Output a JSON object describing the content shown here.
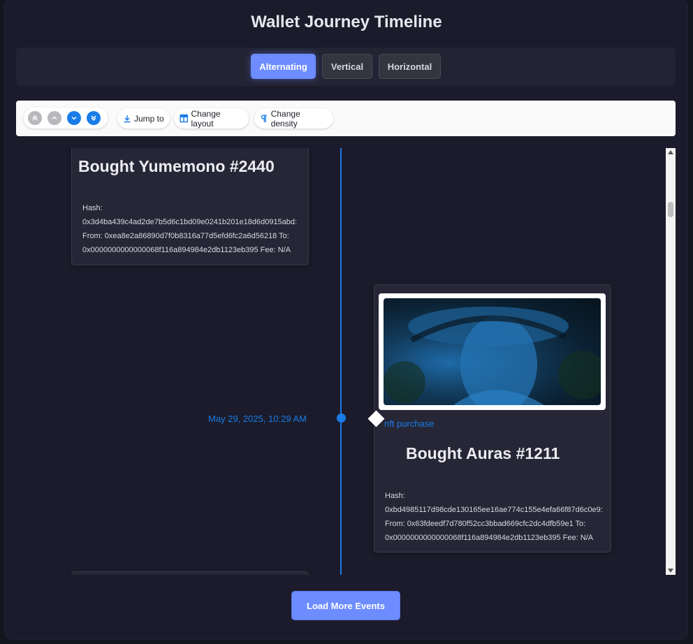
{
  "page": {
    "title": "Wallet Journey Timeline"
  },
  "layout_modes": {
    "buttons": [
      "Alternating",
      "Vertical",
      "Horizontal"
    ],
    "active": "Alternating"
  },
  "toolbar": {
    "nav_icons": [
      "first-event-icon",
      "previous-event-icon",
      "next-event-icon",
      "last-event-icon"
    ],
    "jump_to": "Jump to",
    "change_layout": "Change layout",
    "change_density": "Change density"
  },
  "events": [
    {
      "title": "Bought Yumemono #2440",
      "hash_label": "Hash:",
      "hash": "0x3d4ba439c4ad2de7b5d6c1bd09e0241b201e18d6d0915abd:",
      "from_to": "From: 0xea8e2a86890d7f0b8316a77d5efd6fc2a6d56218 To:",
      "to_fee": "0x0000000000000068f116a894984e2db1123eb395 Fee: N/A"
    },
    {
      "date": "May 29, 2025, 10:29 AM",
      "type": "nft purchase",
      "title": "Bought Auras #1211",
      "hash_label": "Hash:",
      "hash": "0xbd4985117d98cde130165ee16ae774c155e4efa66f87d6c0e9:",
      "from_to": "From: 0x63fdeedf7d780f52cc3bbad669cfc2dc4dfb59e1 To:",
      "to_fee": "0x0000000000000068f116a894984e2db1123eb395 Fee: N/A"
    }
  ],
  "load_more": "Load More Events",
  "colors": {
    "accent": "#6d8cff",
    "timeline": "#1a7ce8",
    "background": "#1b1b2b",
    "card": "#262636"
  }
}
